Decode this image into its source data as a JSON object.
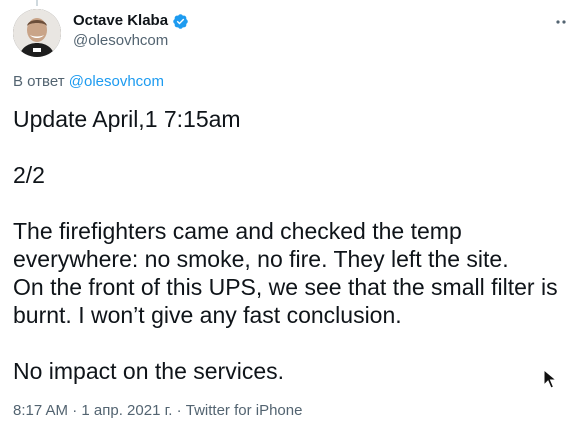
{
  "author": {
    "display_name": "Octave Klaba",
    "handle": "@olesovhcom",
    "verified": true
  },
  "reply": {
    "prefix": "В ответ",
    "mention": "@olesovhcom"
  },
  "tweet": {
    "line1": "Update April,1 7:15am",
    "line2": "2/2",
    "line3": "The firefighters came and checked the temp everywhere: no smoke, no fire. They left the site.",
    "line4": "On the front of this UPS, we see that the small filter is burnt. I won’t give any fast conclusion.",
    "line5": "No impact on the services."
  },
  "meta": {
    "time": "8:17 AM",
    "separator": "·",
    "date": "1 апр. 2021 г.",
    "source": "Twitter for iPhone"
  },
  "icons": {
    "verified": "verified-badge-icon",
    "more": "more-options-icon",
    "cursor": "mouse-pointer-icon"
  },
  "colors": {
    "accent": "#1d9bf0",
    "text": "#0f1419",
    "secondary": "#536471"
  }
}
